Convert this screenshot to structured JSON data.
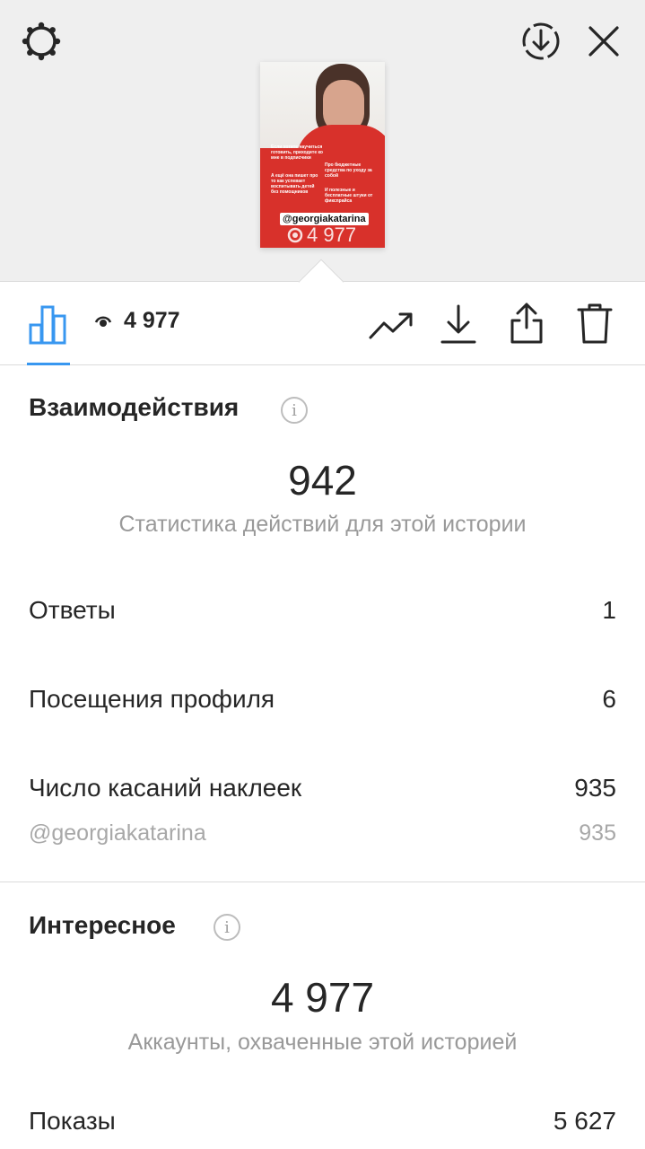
{
  "preview": {
    "mention_tag": "@georgiakatarina",
    "views_overlay": "4 977",
    "story_lines": [
      "Если хотите научиться готовить, приходите ко мне в подписчики",
      "А ещё она пишет про то как успевает воспитывать детей без помощников",
      "Про бюджетные средства по уходу за собой",
      "И полезные и бесплатные штуки от фикспрайса"
    ]
  },
  "toolbar": {
    "views_count": "4 977"
  },
  "interactions": {
    "title": "Взаимодействия",
    "info_glyph": "i",
    "total": "942",
    "subtitle": "Статистика действий для этой истории",
    "rows": [
      {
        "label": "Ответы",
        "value": "1"
      },
      {
        "label": "Посещения профиля",
        "value": "6"
      },
      {
        "label": "Число касаний наклеек",
        "value": "935"
      }
    ],
    "sub_row": {
      "label": "@georgiakatarina",
      "value": "935"
    }
  },
  "discovery": {
    "title": "Интересное",
    "info_glyph": "i",
    "total": "4 977",
    "subtitle": "Аккаунты, охваченные этой историей",
    "rows": [
      {
        "label": "Показы",
        "value": "5 627"
      }
    ]
  },
  "colors": {
    "accent": "#3897f0",
    "story_bg": "#d8312b"
  },
  "icons": [
    "settings-gear-icon",
    "download-circle-icon",
    "close-icon",
    "bar-chart-icon",
    "eye-icon",
    "trending-icon",
    "download-icon",
    "share-icon",
    "trash-icon",
    "info-icon"
  ]
}
